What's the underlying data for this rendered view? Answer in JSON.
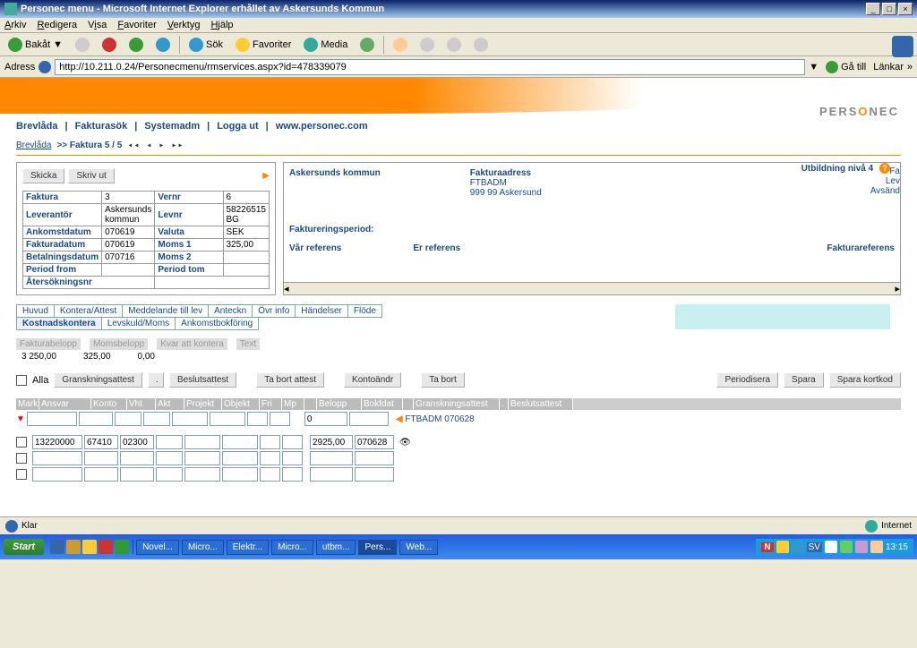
{
  "window": {
    "title": "Personec menu - Microsoft Internet Explorer erhållet av Askersunds Kommun",
    "min": "_",
    "max": "□",
    "close": "×"
  },
  "menu": {
    "arkiv": "Arkiv",
    "redigera": "Redigera",
    "visa": "Visa",
    "favoriter": "Favoriter",
    "verktyg": "Verktyg",
    "hjalp": "Hjälp"
  },
  "toolbar": {
    "back": "Bakåt",
    "sok": "Sök",
    "favoriter": "Favoriter",
    "media": "Media"
  },
  "address": {
    "label": "Adress",
    "url": "http://10.211.0.24/Personecmenu/rmservices.aspx?id=478339079",
    "go": "Gå till",
    "links": "Länkar"
  },
  "nav": {
    "brevlada": "Brevlåda",
    "fakturasok": "Fakturasök",
    "systemadm": "Systemadm",
    "logga_ut": "Logga ut",
    "url": "www.personec.com"
  },
  "logo": {
    "p1": "PERS",
    "p2": "O",
    "p3": "NEC"
  },
  "breadcrumb": {
    "a": "Brevlåda",
    "b": ">> Faktura 5 / 5",
    "arrows": "◂◂ ◂ ▸ ▸▸"
  },
  "user_level": "Utbildning nivå 4",
  "buttons": {
    "skicka": "Skicka",
    "skriv_ut": "Skriv ut"
  },
  "info": {
    "faktura_l": "Faktura",
    "faktura_v": "3",
    "vernr_l": "Vernr",
    "vernr_v": "6",
    "leverantor_l": "Leverantör",
    "leverantor_v": "Askersunds kommun",
    "levnr_l": "Levnr",
    "levnr_v": "58226515 BG",
    "ankomst_l": "Ankomstdatum",
    "ankomst_v": "070619",
    "valuta_l": "Valuta",
    "valuta_v": "SEK",
    "fakturadat_l": "Fakturadatum",
    "fakturadat_v": "070619",
    "moms1_l": "Moms 1",
    "moms1_v": "325,00",
    "betal_l": "Betalningsdatum",
    "betal_v": "070716",
    "moms2_l": "Moms 2",
    "moms2_v": "",
    "pfrom_l": "Period from",
    "ptom_l": "Period tom",
    "atersok_l": "Återsökningsnr"
  },
  "right": {
    "kommun": "Askersunds kommun",
    "faktadr_l": "Fakturaadress",
    "ftbadm": "FTBADM",
    "zip": "999 99 Askersund",
    "fa": "Fa",
    "lev": "Lev",
    "avsand": "Avsänd",
    "period_l": "Faktureringsperiod:",
    "varref": "Vår referens",
    "erref": "Er referens",
    "fakref": "Fakturareferens"
  },
  "tabs1": [
    "Huvud",
    "Kontera/Attest",
    "Meddelande till lev",
    "Anteckn",
    "Övr info",
    "Händelser",
    "Flöde"
  ],
  "tabs2": [
    "Kostnadskontera",
    "Levskuld/Moms",
    "Ankomstbokföring"
  ],
  "sums": {
    "h1": "Fakturabelopp",
    "h2": "Momsbelopp",
    "h3": "Kvar att kontera",
    "h4": "Text",
    "v1": "3 250,00",
    "v2": "325,00",
    "v3": "0,00"
  },
  "actions": {
    "alla": "Alla",
    "gransk": "Granskningsattest",
    "dot": ".",
    "beslut": "Beslutsattest",
    "tabort_att": "Ta bort attest",
    "kontoandr": "Kontoändr",
    "tabort": "Ta bort",
    "periodisera": "Periodisera",
    "spara": "Spara",
    "spara_kort": "Spara kortkod"
  },
  "grid": {
    "headers": [
      "Mark",
      "Ansvar",
      "Konto",
      "Vht",
      "Akt",
      "Projekt",
      "Objekt",
      "Fri",
      "Mp",
      "",
      "Belopp",
      "Bokfdat",
      "",
      "Granskningsattest",
      ".",
      "Beslutsattest"
    ],
    "row0": {
      "belopp": "0",
      "chip": "FTBADM 070628"
    },
    "row1": {
      "ansvar": "13220000",
      "konto": "67410",
      "vht": "02300",
      "belopp": "2925,00",
      "bokfdat": "070628"
    }
  },
  "status": {
    "klar": "Klar",
    "zone": "Internet"
  },
  "taskbar": {
    "start": "Start",
    "items": [
      "Novel...",
      "Micro...",
      "Elektr...",
      "Micro...",
      "utbm...",
      "Pers...",
      "Web..."
    ],
    "tray": {
      "n": "N",
      "sv": "SV",
      "time": "13:15"
    }
  }
}
